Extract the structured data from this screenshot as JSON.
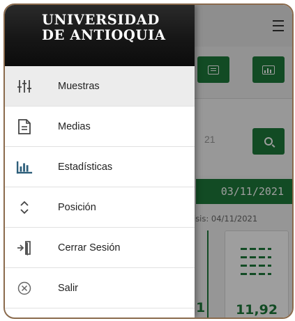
{
  "brand": {
    "line1": "UNIVERSIDAD",
    "line2": "DE ANTIOQUIA"
  },
  "drawer": {
    "items": [
      {
        "label": "Muestras",
        "icon": "sliders-icon",
        "active": true
      },
      {
        "label": "Medias",
        "icon": "document-icon"
      },
      {
        "label": "Estadísticas",
        "icon": "bar-chart-icon"
      },
      {
        "label": "Posición",
        "icon": "chevron-up-down-icon"
      },
      {
        "label": "Cerrar Sesión",
        "icon": "logout-icon"
      },
      {
        "label": "Salir",
        "icon": "close-circle-icon"
      }
    ]
  },
  "background": {
    "date_partial": "21",
    "date_bar": "03/11/2021",
    "analysis_partial": "isis: 04/11/2021",
    "card_value": "11,92",
    "left_value": "1"
  },
  "colors": {
    "accent_green": "#1e7a3b",
    "drawer_header": "#111111",
    "border": "#8a6a4c"
  }
}
